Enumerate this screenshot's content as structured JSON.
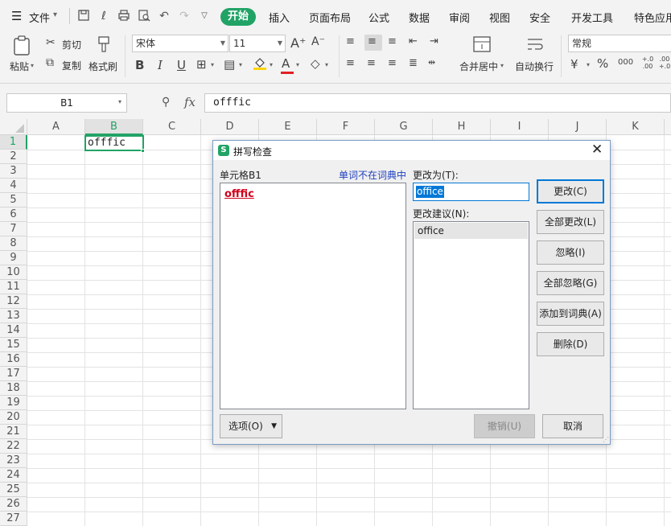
{
  "menubar": {
    "file_label": "文件",
    "tabs": [
      "开始",
      "插入",
      "页面布局",
      "公式",
      "数据",
      "审阅",
      "视图",
      "安全",
      "开发工具",
      "特色应用"
    ]
  },
  "ribbon": {
    "paste_label": "粘贴",
    "cut_label": "剪切",
    "copy_label": "复制",
    "format_painter_label": "格式刷",
    "font_name": "宋体",
    "font_size": "11",
    "merge_label": "合并居中",
    "wrap_label": "自动换行",
    "number_format": "常规",
    "bold": "B",
    "italic": "I",
    "underline": "U",
    "font_color_glyph": "A",
    "percent": "%",
    "thousands": "000",
    "inc_decimal": "+.0 .00",
    "dec_decimal": ".00 +.0"
  },
  "formula_bar": {
    "name_box": "B1",
    "fx": "fx",
    "content": "offfic"
  },
  "sheet": {
    "columns": [
      "A",
      "B",
      "C",
      "D",
      "E",
      "F",
      "G",
      "H",
      "I",
      "J",
      "K"
    ],
    "rows": [
      "1",
      "2",
      "3",
      "4",
      "5",
      "6",
      "7",
      "8",
      "9",
      "10",
      "11",
      "12",
      "13",
      "14",
      "15",
      "16",
      "17",
      "18",
      "19",
      "20",
      "21",
      "22",
      "23",
      "24",
      "25",
      "26",
      "27"
    ],
    "cell_b1": "offfic"
  },
  "dialog": {
    "title": "拼写检查",
    "cell_label": "单元格B1",
    "not_in_dict": "单词不在词典中",
    "misspelled_word": "offfic",
    "change_to_label": "更改为(T):",
    "change_to_value": "office",
    "suggestions_label": "更改建议(N):",
    "suggestions": [
      "office"
    ],
    "buttons": {
      "change": "更改(C)",
      "change_all": "全部更改(L)",
      "ignore": "忽略(I)",
      "ignore_all": "全部忽略(G)",
      "add_to_dict": "添加到词典(A)",
      "delete": "删除(D)",
      "options": "选项(O)",
      "undo": "撤销(U)",
      "cancel": "取消"
    }
  },
  "colors": {
    "accent_green": "#21a366",
    "misspelled_red": "#d0021b",
    "selection_blue": "#0078d7",
    "link_blue": "#1f3fbf"
  }
}
